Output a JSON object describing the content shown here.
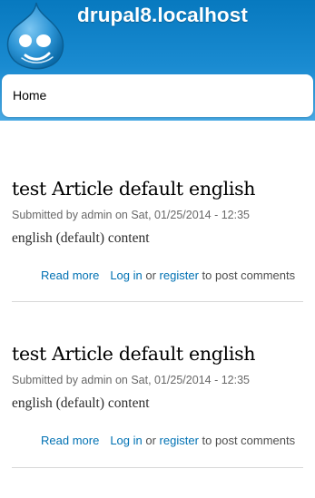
{
  "site": {
    "name": "drupal8.localhost",
    "logo_icon": "drupal-drop-logo",
    "brand_color": "#0779bf"
  },
  "nav": {
    "home_label": "Home"
  },
  "articles": [
    {
      "title": "test Article default english",
      "submitted": "Submitted by admin on Sat, 01/25/2014 - 12:35",
      "body": "english (default) content",
      "read_more": "Read more",
      "login": "Log in",
      "or": "or",
      "register": "register",
      "post_comments": "to post comments"
    },
    {
      "title": "test Article default english",
      "submitted": "Submitted by admin on Sat, 01/25/2014 - 12:35",
      "body": "english (default) content",
      "read_more": "Read more",
      "login": "Log in",
      "or": "or",
      "register": "register",
      "post_comments": "to post comments"
    }
  ],
  "colors": {
    "link": "#0071b3",
    "divider": "#d8d8d8"
  }
}
